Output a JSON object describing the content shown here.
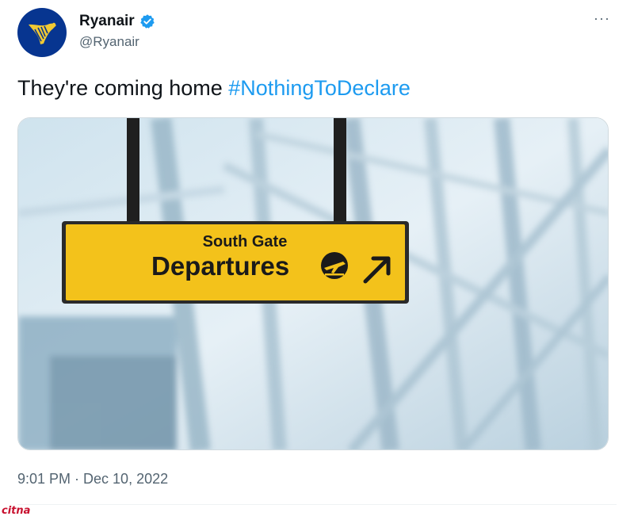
{
  "author": {
    "display_name": "Ryanair",
    "handle": "@Ryanair",
    "verified": true,
    "avatar_icon": "ryanair-harp-logo-icon",
    "avatar_color": "#073590",
    "logo_color": "#f1c933"
  },
  "more_menu": {
    "label": "···",
    "icon": "more-horizontal-icon"
  },
  "tweet": {
    "text": "They're coming home ",
    "hashtag": "#NothingToDeclare",
    "hashtag_color": "#1d9bf0"
  },
  "media": {
    "sign_line1": "South Gate",
    "sign_line2": "Departures",
    "sign_color": "#f3c21b",
    "sign_icons": [
      "departure-plane-icon",
      "arrow-up-right-icon"
    ]
  },
  "timestamp": "9:01 PM · Dec 10, 2022",
  "watermark": "citna"
}
